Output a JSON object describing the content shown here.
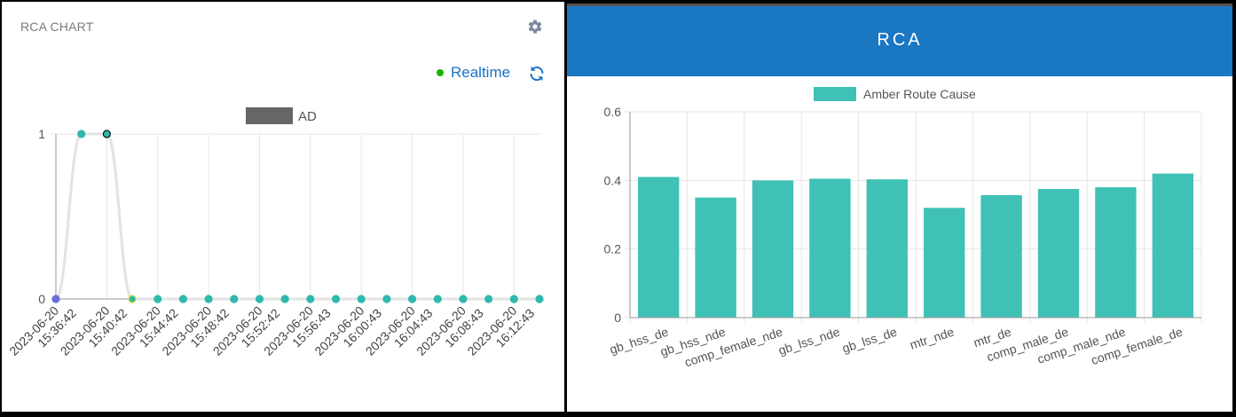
{
  "left_panel": {
    "title": "RCA CHART",
    "realtime_label": "Realtime",
    "settings_icon": "gear-icon",
    "refresh_icon": "refresh-icon",
    "status_color": "#19b400",
    "link_color": "#1a73c8"
  },
  "right_panel": {
    "title": "RCA",
    "header_color": "#1a77c2"
  },
  "chart_data": [
    {
      "type": "line",
      "series": [
        {
          "name": "AD",
          "values": [
            0,
            1,
            1,
            0,
            0,
            0,
            0,
            0,
            0,
            0,
            0,
            0,
            0,
            0,
            0,
            0,
            0,
            0,
            0,
            0
          ],
          "color": "#666666"
        }
      ],
      "x_tick_labels": [
        [
          "2023-06-20",
          "15:36:42"
        ],
        [
          "2023-06-20",
          "15:40:42"
        ],
        [
          "2023-06-20",
          "15:44:42"
        ],
        [
          "2023-06-20",
          "15:48:42"
        ],
        [
          "2023-06-20",
          "15:52:42"
        ],
        [
          "2023-06-20",
          "15:56:43"
        ],
        [
          "2023-06-20",
          "16:00:43"
        ],
        [
          "2023-06-20",
          "16:04:43"
        ],
        [
          "2023-06-20",
          "16:08:43"
        ],
        [
          "2023-06-20",
          "16:12:43"
        ]
      ],
      "y_ticks": [
        "0",
        "1"
      ],
      "ylim": [
        0,
        1
      ],
      "grid": true,
      "legend_position": "top-center"
    },
    {
      "type": "bar",
      "categories": [
        "gb_hss_de",
        "gb_hss_nde",
        "comp_female_nde",
        "gb_lss_nde",
        "gb_lss_de",
        "mtr_nde",
        "mtr_de",
        "comp_male_de",
        "comp_male_nde",
        "comp_female_de"
      ],
      "series": [
        {
          "name": "Amber Route Cause",
          "values": [
            0.41,
            0.35,
            0.4,
            0.405,
            0.403,
            0.32,
            0.357,
            0.375,
            0.38,
            0.42
          ],
          "color": "#3fc1b6"
        }
      ],
      "y_ticks": [
        "0",
        "0.2",
        "0.4",
        "0.6"
      ],
      "ylim": [
        0,
        0.6
      ],
      "grid": true,
      "legend_position": "top-center"
    }
  ]
}
